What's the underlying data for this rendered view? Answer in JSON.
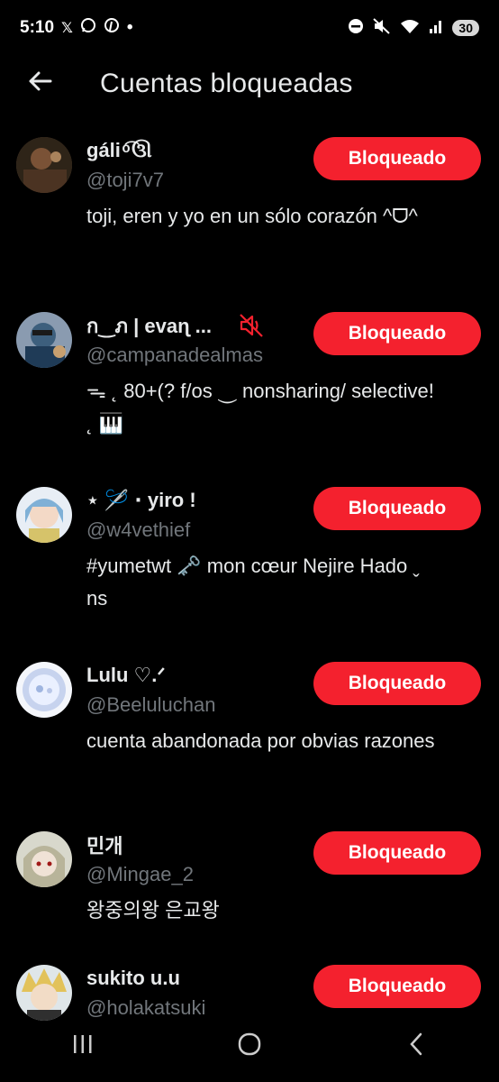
{
  "status_bar": {
    "time": "5:10",
    "left_icons": [
      "x-icon",
      "whatsapp-icon",
      "pinterest-icon",
      "dot-icon"
    ],
    "right_icons": [
      "dnd-icon",
      "mute-icon",
      "wifi-icon",
      "signal-icon"
    ],
    "battery": "30"
  },
  "header": {
    "back_icon": "arrow-left-icon",
    "title": "Cuentas bloqueadas"
  },
  "accounts": [
    {
      "name": "gáli ͦ͡ ઊ",
      "handle": "@toji7v7",
      "bio": "toji, eren y yo en un sólo corazón ^ᗜ^",
      "button": "Bloqueado",
      "avatar_color": "#5a4030",
      "muted": false
    },
    {
      "name": "ก‿ภ | evaɳ ...",
      "handle": "@campanadealmas",
      "bio": "ᯓ ˛  80+(? f/os  ⏝  nonsharing/ selective! ˛ 🎹",
      "button": "Bloqueado",
      "avatar_color": "#3b5a78",
      "muted": true
    },
    {
      "name": "⋆ 🪡 ⋅ yiro  !",
      "handle": "@w4vethief",
      "bio": "#yumetwt  🗝️  mon  cœur  Nejire Hado  ˬ   ns",
      "button": "Bloqueado",
      "avatar_color": "#6b8cae",
      "muted": false
    },
    {
      "name": "Lulu ♡.ᐟ",
      "handle": "@Beeluluchan",
      "bio": "cuenta abandonada por obvias razones",
      "button": "Bloqueado",
      "avatar_color": "#c8d6f0",
      "muted": false
    },
    {
      "name": "민개",
      "handle": "@Mingae_2",
      "bio": "왕중의왕 은교왕",
      "button": "Bloqueado",
      "avatar_color": "#9a9a8a",
      "muted": false
    },
    {
      "name": "sukito u.u",
      "handle": "@holakatsuki",
      "bio": "",
      "button": "Bloqueado",
      "avatar_color": "#c9a24a",
      "muted": false
    }
  ],
  "nav_bar": {
    "recents_icon": "recents-icon",
    "home_icon": "home-icon",
    "back_icon": "back-chevron-icon"
  }
}
